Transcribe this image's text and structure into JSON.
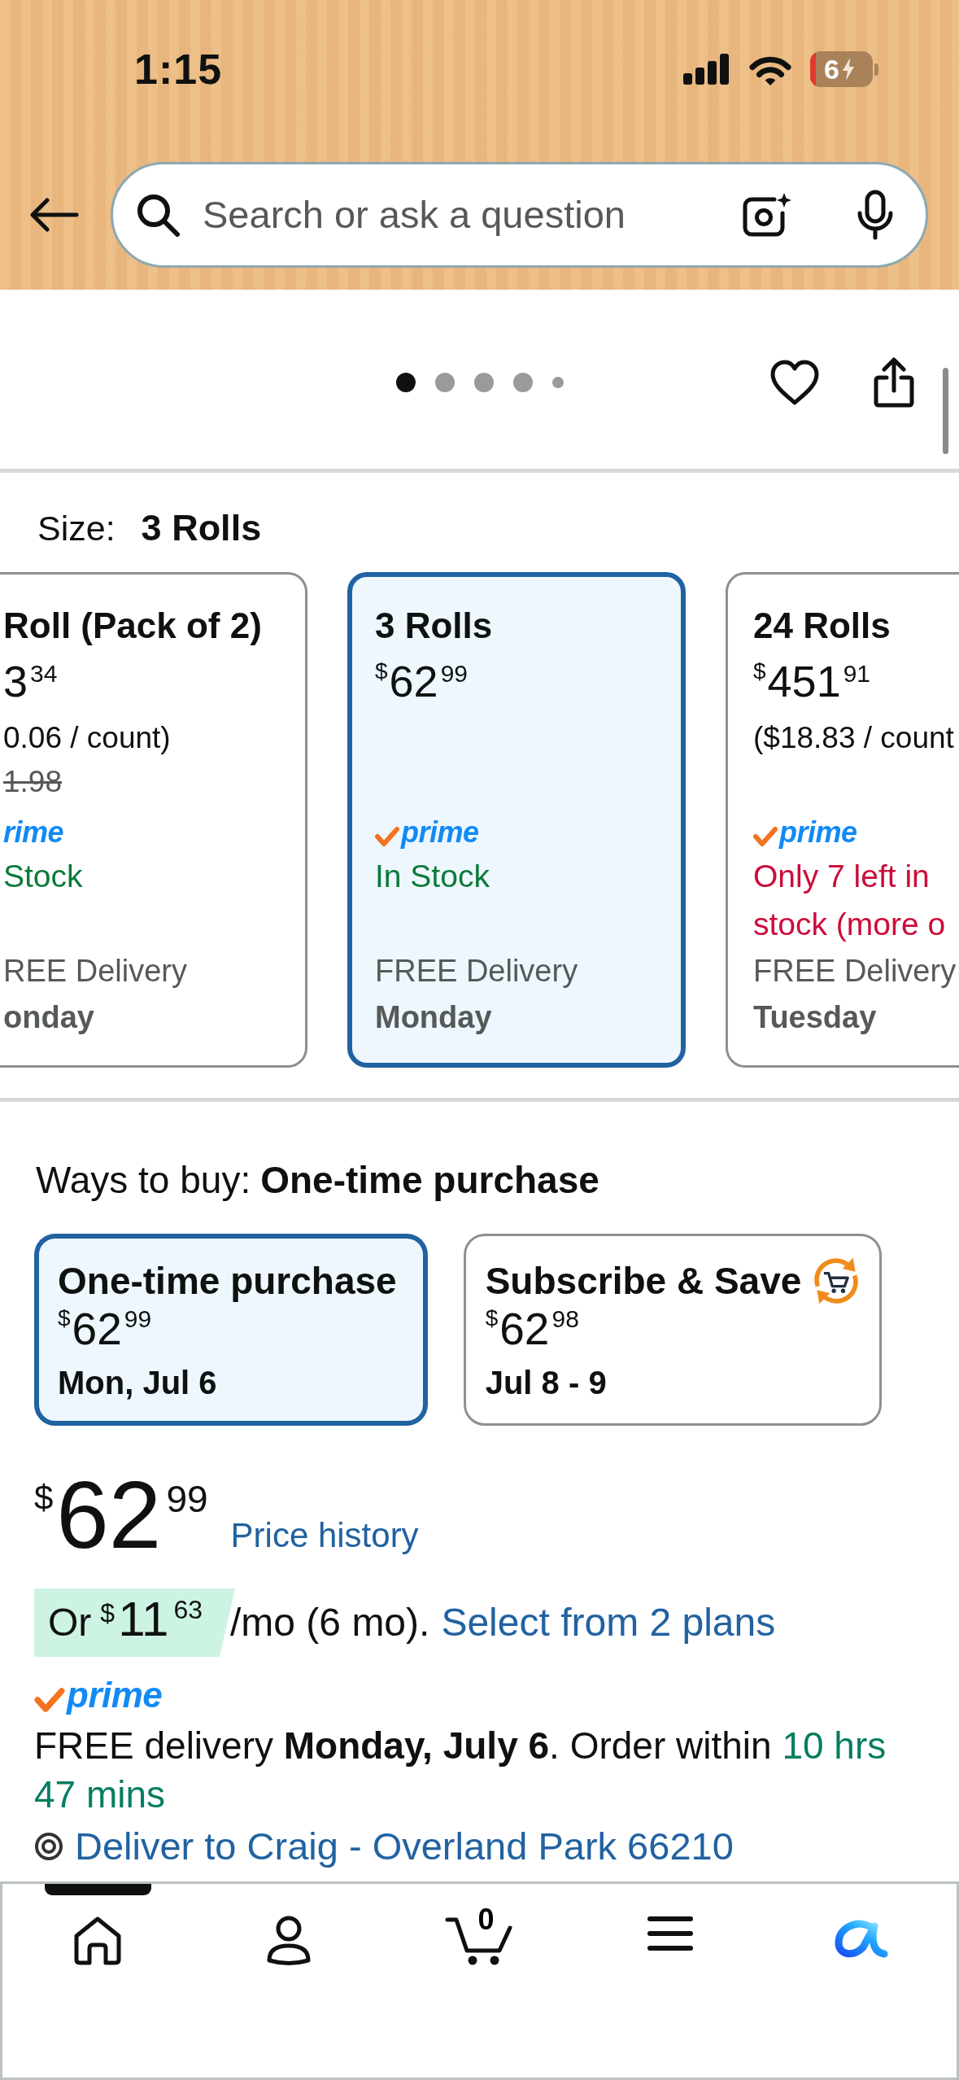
{
  "status_bar": {
    "time": "1:15",
    "battery_percent": "6"
  },
  "search": {
    "placeholder": "Search or ask a question"
  },
  "gallery": {
    "dots": [
      {
        "selected": true,
        "kind": "full"
      },
      {
        "selected": false,
        "kind": "full"
      },
      {
        "selected": false,
        "kind": "full"
      },
      {
        "selected": false,
        "kind": "full"
      },
      {
        "selected": false,
        "kind": "small"
      }
    ]
  },
  "size": {
    "label": "Size:",
    "value": "3 Rolls",
    "options": [
      {
        "title": "Roll (Pack of 2)",
        "price": {
          "whole": "3",
          "fraction": "34"
        },
        "unit_price": "0.06 / count)",
        "list_price": "1.98",
        "prime": {
          "check": false,
          "label": "rime"
        },
        "availability": {
          "kind": "in_stock",
          "text": "Stock"
        },
        "delivery": "REE Delivery",
        "delivery_day": "onday",
        "selected": false
      },
      {
        "title": "3 Rolls",
        "price": {
          "currency": "$",
          "whole": "62",
          "fraction": "99"
        },
        "prime": {
          "check": true,
          "label": "prime"
        },
        "availability": {
          "kind": "in_stock",
          "text": "In Stock"
        },
        "delivery": "FREE Delivery",
        "delivery_day": "Monday",
        "selected": true
      },
      {
        "title": "24 Rolls",
        "price": {
          "currency": "$",
          "whole": "451",
          "fraction": "91"
        },
        "unit_price": "($18.83 / count",
        "prime": {
          "check": true,
          "label": "prime"
        },
        "availability": {
          "kind": "low_stock",
          "text": "Only 7 left in stock (more o"
        },
        "delivery": "FREE Delivery",
        "delivery_day": "Tuesday",
        "selected": false
      }
    ]
  },
  "ways_to_buy": {
    "label": "Ways to buy:",
    "value": "One-time purchase",
    "options": [
      {
        "kind": "one_time",
        "title": "One-time purchase",
        "price": {
          "currency": "$",
          "whole": "62",
          "fraction": "99"
        },
        "delivery": "Mon, Jul 6",
        "selected": true
      },
      {
        "kind": "subscribe",
        "title": "Subscribe & Save",
        "price": {
          "currency": "$",
          "whole": "62",
          "fraction": "98"
        },
        "delivery": "Jul 8 - 9",
        "selected": false
      }
    ]
  },
  "price": {
    "currency": "$",
    "whole": "62",
    "fraction": "99"
  },
  "price_history": "Price history",
  "installment": {
    "prefix": "Or",
    "price": {
      "currency": "$",
      "whole": "11",
      "fraction": "63"
    },
    "term": "/mo (6 mo).",
    "link": "Select from 2 plans"
  },
  "prime": {
    "check": true,
    "label": "prime"
  },
  "delivery": {
    "message": "FREE delivery **Monday, July 6**. Order within",
    "countdown": "10 hrs 47 mins"
  },
  "deliver_to": "Deliver to Craig - Overland Park 66210",
  "bottom_nav": [
    {
      "kind": "home",
      "selected": true
    },
    {
      "kind": "account",
      "selected": false
    },
    {
      "kind": "cart",
      "selected": false,
      "count": "0"
    },
    {
      "kind": "menu",
      "selected": false
    },
    {
      "kind": "assistant",
      "selected": false
    }
  ]
}
